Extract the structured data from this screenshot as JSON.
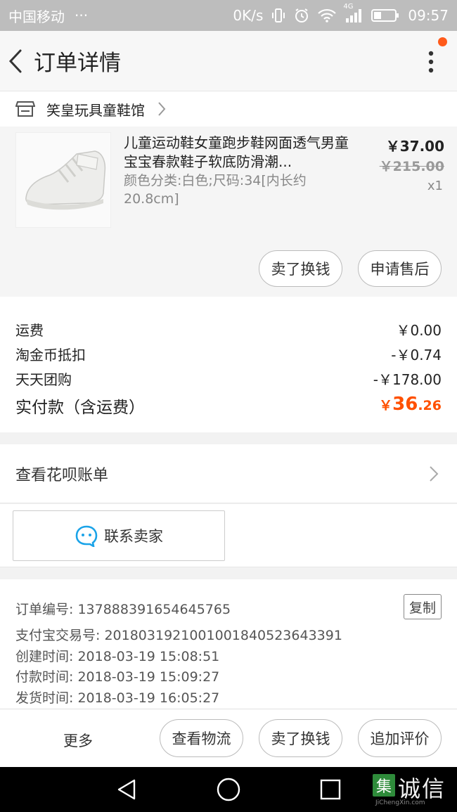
{
  "status_bar": {
    "carrier": "中国移动",
    "dots": "···",
    "speed": "0K/s",
    "network": "4G",
    "time": "09:57"
  },
  "header": {
    "title": "订单详情",
    "back_icon": "chevron-left-icon",
    "more_icon": "vertical-dots-icon",
    "notify_color": "#ff5a1a"
  },
  "shop": {
    "name": "笑皇玩具童鞋馆",
    "icon": "store-icon"
  },
  "product": {
    "title": "儿童运动鞋女童跑步鞋网面透气男童宝宝春款鞋子软底防滑潮...",
    "spec": "颜色分类:白色;尺码:34[内长约20.8cm]",
    "price": "￥37.00",
    "original_price": "￥215.00",
    "quantity": "x1",
    "buttons": {
      "sell": "卖了换钱",
      "after_sale": "申请售后"
    }
  },
  "fees": [
    {
      "label": "运费",
      "value": "￥0.00"
    },
    {
      "label": "淘金币抵扣",
      "value": "-￥0.74"
    },
    {
      "label": "天天团购",
      "value": "-￥178.00"
    }
  ],
  "total": {
    "label": "实付款（含运费）",
    "currency": "￥",
    "integer": "36",
    "decimal": ".26",
    "color": "#ff5000"
  },
  "huabei": {
    "label": "查看花呗账单"
  },
  "contact": {
    "label": "联系卖家",
    "icon": "chat-bubble-icon",
    "icon_color": "#1aa3e8"
  },
  "order_info": {
    "order_no_label": "订单编号:",
    "order_no": "137888391654645765",
    "copy": "复制",
    "alipay_label": "支付宝交易号:",
    "alipay_no": "2018031921001001840523643391",
    "created_label": "创建时间:",
    "created": "2018-03-19 15:08:51",
    "paid_label": "付款时间:",
    "paid": "2018-03-19 15:09:27",
    "shipped_label": "发货时间:",
    "shipped": "2018-03-19 16:05:27"
  },
  "bottom_bar": {
    "more": "更多",
    "logistics": "查看物流",
    "sell": "卖了换钱",
    "review": "追加评价"
  },
  "watermark": {
    "logo": "集",
    "text": "诚信",
    "url": "JiChengXin.com"
  }
}
